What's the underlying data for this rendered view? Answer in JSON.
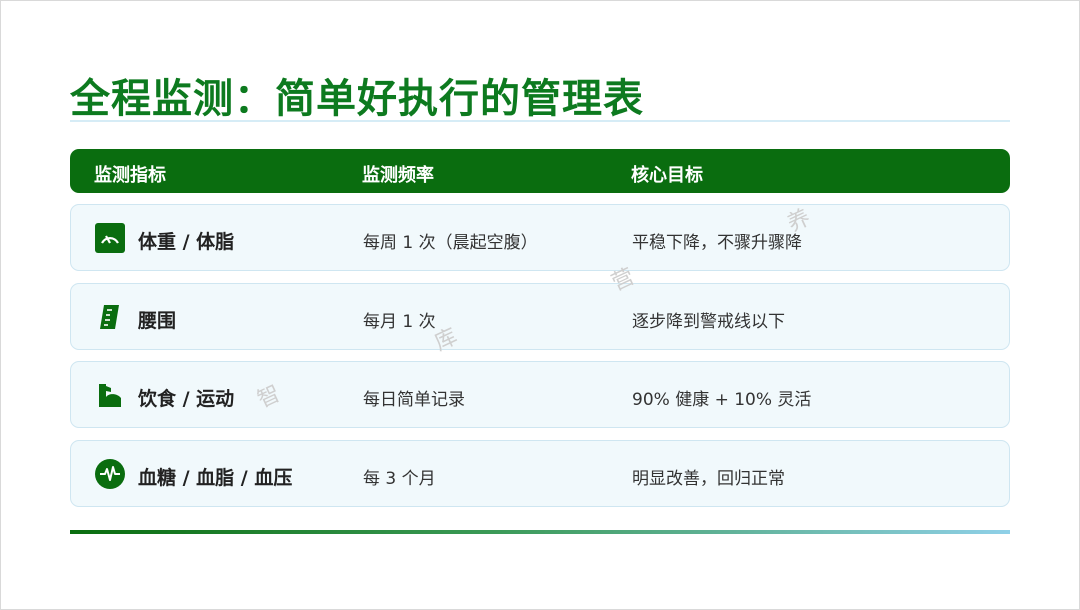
{
  "title": "全程监测：简单好执行的管理表",
  "table": {
    "headers": [
      "监测指标",
      "监测频率",
      "核心目标"
    ],
    "rows": [
      {
        "icon": "gauge-icon",
        "metric": "体重 / 体脂",
        "frequency": "每周 1 次（晨起空腹）",
        "goal": "平稳下降，不骤升骤降"
      },
      {
        "icon": "ruler-icon",
        "metric": "腰围",
        "frequency": "每月 1 次",
        "goal": "逐步降到警戒线以下"
      },
      {
        "icon": "flexed-arm-icon",
        "metric": "饮食 / 运动",
        "frequency": "每日简单记录",
        "goal": "90% 健康 + 10% 灵活"
      },
      {
        "icon": "heartbeat-icon",
        "metric": "血糖 / 血脂 / 血压",
        "frequency": "每 3 个月",
        "goal": "明显改善，回归正常"
      }
    ]
  },
  "watermark": [
    "养",
    "营",
    "库",
    "智"
  ],
  "colors": {
    "accent": "#0a6d0f",
    "title": "#0d7a1f",
    "row_bg": "#f1f9fc"
  }
}
